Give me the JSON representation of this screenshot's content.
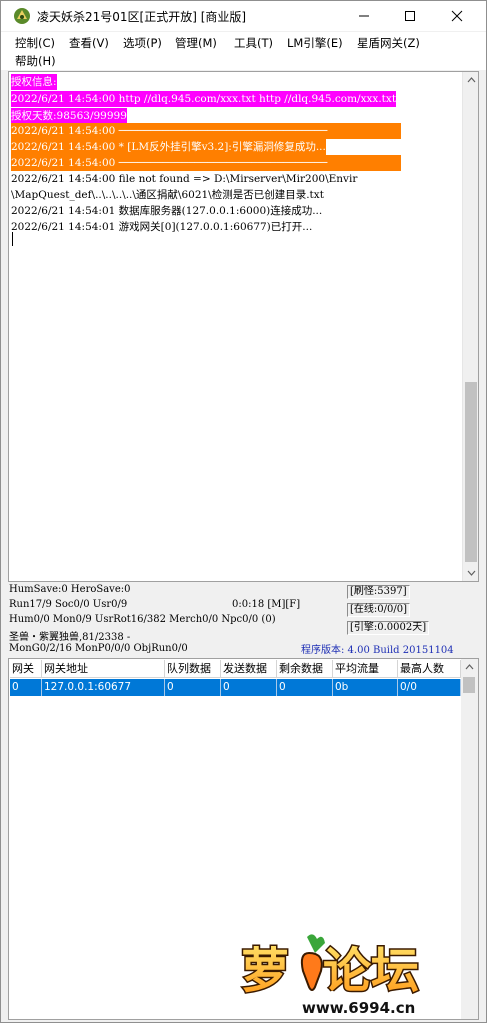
{
  "window": {
    "title": "凌天妖杀21号01区[正式开放] [商业版]",
    "icon": "dragon-app-icon"
  },
  "menu": {
    "items": [
      {
        "label": "控制",
        "key": "(C)"
      },
      {
        "label": "查看",
        "key": "(V)"
      },
      {
        "label": "选项",
        "key": "(P)"
      },
      {
        "label": "管理",
        "key": "(M)"
      },
      {
        "label": "工具",
        "key": "(T)"
      },
      {
        "label": "LM引擎",
        "key": "(E)"
      },
      {
        "label": "星盾网关",
        "key": "(Z)"
      },
      {
        "label": "帮助",
        "key": "(H)"
      }
    ]
  },
  "log": {
    "lines": [
      {
        "text": "授权信息:",
        "style": "magenta"
      },
      {
        "text": "2022/6/21 14:54:00 http //dlq.945.com/xxx.txt http //dlq.945.com/xxx.txt",
        "style": "magenta"
      },
      {
        "text": "授权天数:98563/99999",
        "style": "magenta"
      },
      {
        "text": "2022/6/21 14:54:00 ─────────────────────────────────",
        "style": "orange"
      },
      {
        "text": "2022/6/21 14:54:00 * [LM反外挂引擎v3.2]:引擎漏洞修复成功...",
        "style": "orange"
      },
      {
        "text": "2022/6/21 14:54:00 ─────────────────────────────────",
        "style": "orange"
      },
      {
        "text": "2022/6/21 14:54:00 file not found => D:\\Mirserver\\Mir200\\Envir",
        "style": "normal"
      },
      {
        "text": "\\MapQuest_def\\..\\..\\..\\..\\通区捐献\\6021\\检测是否已创建目录.txt",
        "style": "normal"
      },
      {
        "text": "2022/6/21 14:54:01 数据库服务器(127.0.0.1:6000)连接成功...",
        "style": "normal"
      },
      {
        "text": "2022/6/21 14:54:01 游戏网关[0](127.0.0.1:60677)已打开...",
        "style": "normal"
      }
    ]
  },
  "status": {
    "line1": "HumSave:0 HeroSave:0",
    "line2": "Run17/9 Soc0/0 Usr0/9",
    "timer": "0:0:18 [M][F]",
    "line3": "Hum0/0 Mon0/9 UsrRot16/382 Merch0/0 Npc0/0 (0)",
    "line4": "圣兽・紫翼独兽,81/2338 -",
    "line5": "MonG0/2/16 MonP0/0/0 ObjRun0/0",
    "refresh": "[刷怪:5397]",
    "online": "[在线:0/0/0]",
    "engine": "[引擎:0.0002天]",
    "version": "程序版本: 4.00 Build 20151104"
  },
  "gateway_table": {
    "columns": [
      "网关",
      "网关地址",
      "队列数据",
      "发送数据",
      "剩余数据",
      "平均流量",
      "最高人数"
    ],
    "rows": [
      [
        "0",
        "127.0.0.1:60677",
        "0",
        "0",
        "0",
        "0b",
        "0/0"
      ]
    ]
  },
  "watermark": {
    "text": "萝卜论坛",
    "domain": "www.6994.cn"
  },
  "colors": {
    "magenta": "#ff00ff",
    "orange": "#ff7f00",
    "selection": "#0078d7",
    "version_text": "#1e2fb5"
  }
}
